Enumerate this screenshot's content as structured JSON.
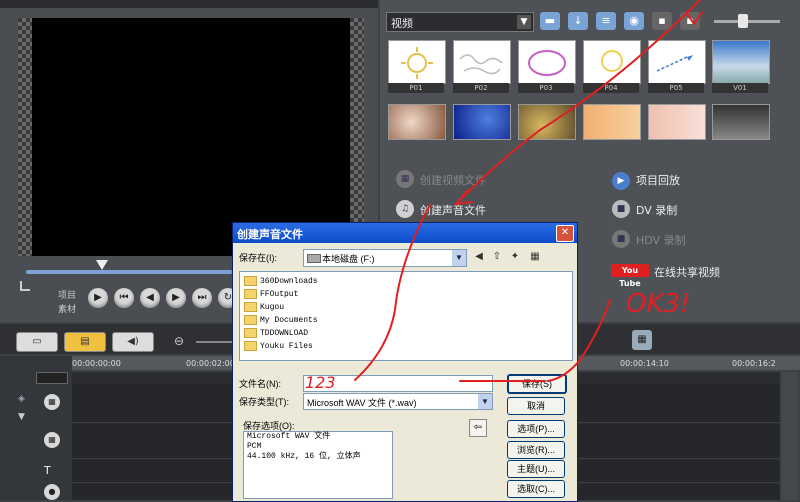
{
  "preview": {
    "project_label": "项目",
    "clip_label": "素材",
    "controls": [
      "play-icon",
      "prev-icon",
      "step-back-icon",
      "step-forward-icon",
      "next-icon",
      "repeat-icon",
      "volume-icon"
    ]
  },
  "library": {
    "category": "视频",
    "thumbnails": [
      "P01",
      "P02",
      "P03",
      "P04",
      "P05",
      "V01",
      "",
      "",
      "",
      "",
      "",
      ""
    ],
    "tasks": {
      "create_video_file": "创建视频文件",
      "create_audio_file": "创建声音文件",
      "project_playback": "项目回放",
      "dv_record": "DV 录制",
      "hdv_record": "HDV 录制",
      "youtube_logo": "You Tube",
      "online_share": "在线共享视频"
    }
  },
  "timeline": {
    "timecodes": [
      "00:00:00:00",
      "00:00:02:00",
      "00:00:14:10",
      "00:00:16:2"
    ]
  },
  "dialog": {
    "title": "创建声音文件",
    "save_in_label": "保存在(I):",
    "save_in_value": "本地磁盘 (F:)",
    "files": [
      "360Downloads",
      "FFOutput",
      "Kugou",
      "My Documents",
      "TDDOWNLOAD",
      "Youku Files"
    ],
    "filename_label": "文件名(N):",
    "filename_value": "",
    "filetype_label": "保存类型(T):",
    "filetype_value": "Microsoft WAV 文件 (*.wav)",
    "options_label": "保存选项(O):",
    "options_lines": [
      "Microsoft WAV 文件",
      "PCM",
      "44.100 kHz, 16 位, 立体声"
    ],
    "buttons": {
      "save": "保存(S)",
      "cancel": "取消",
      "options": "选项(P)...",
      "browse": "浏览(R)...",
      "theme": "主题(U)...",
      "select": "选取(C)..."
    }
  },
  "annotations": {
    "typed_filename": "123",
    "ok_note": "OK3!"
  },
  "colors": {
    "annotation_red": "#e02020",
    "dialog_title_blue": "#0c4cc8",
    "panel_bg": "#4e5156"
  }
}
